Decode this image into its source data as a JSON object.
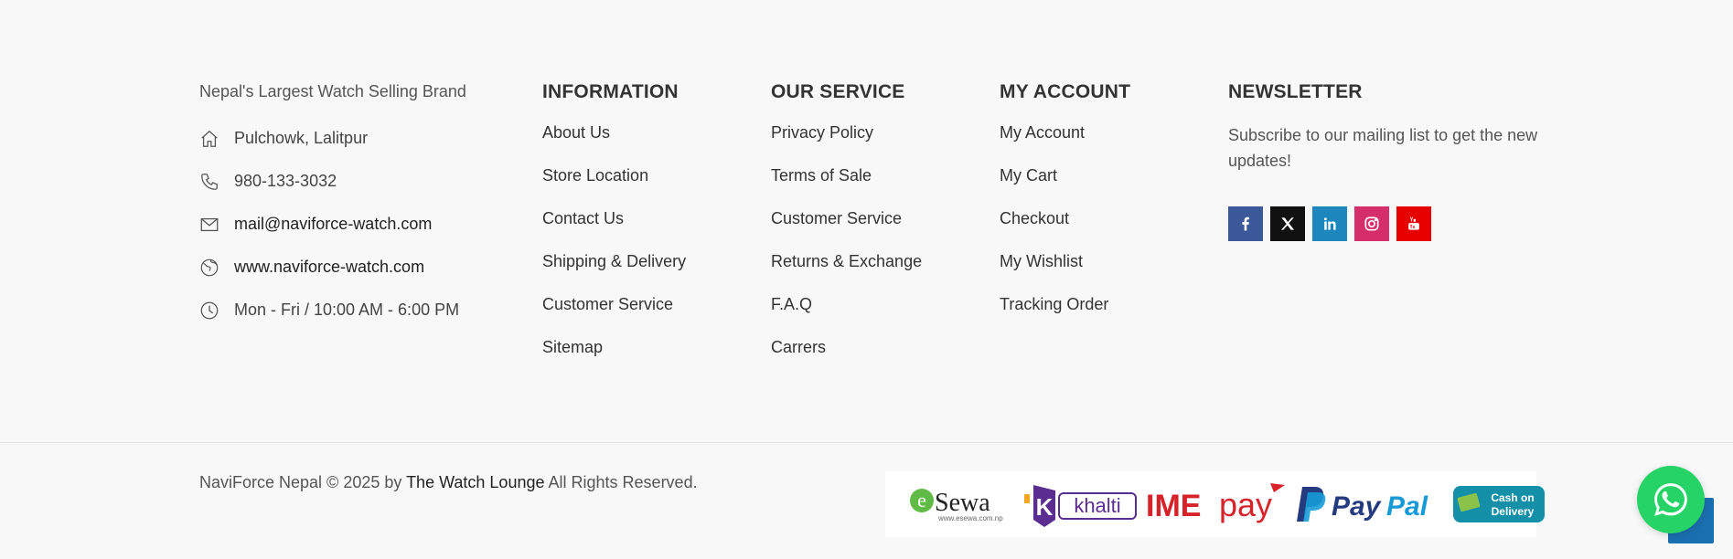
{
  "brand": {
    "tagline": "Nepal's Largest Watch Selling Brand",
    "contacts": [
      {
        "icon": "home-icon",
        "text": "Pulchowk, Lalitpur"
      },
      {
        "icon": "phone-icon",
        "text": "980-133-3032"
      },
      {
        "icon": "mail-icon",
        "text": "mail@naviforce-watch.com"
      },
      {
        "icon": "globe-icon",
        "text": "www.naviforce-watch.com"
      },
      {
        "icon": "clock-icon",
        "text": "Mon - Fri / 10:00 AM - 6:00 PM"
      }
    ]
  },
  "information": {
    "title": "INFORMATION",
    "links": [
      "About Us",
      "Store Location",
      "Contact Us",
      "Shipping & Delivery",
      "Customer Service",
      "Sitemap"
    ]
  },
  "service": {
    "title": "OUR SERVICE",
    "links": [
      "Privacy Policy",
      "Terms of Sale",
      "Customer Service",
      "Returns & Exchange",
      "F.A.Q",
      "Carrers"
    ]
  },
  "account": {
    "title": "MY ACCOUNT",
    "links": [
      "My Account",
      "My Cart",
      "Checkout",
      "My Wishlist",
      "Tracking Order"
    ]
  },
  "newsletter": {
    "title": "NEWSLETTER",
    "text": "Subscribe to our mailing list to get the new updates!",
    "socials": [
      {
        "icon": "facebook-icon",
        "color": "#3b5998"
      },
      {
        "icon": "x-twitter-icon",
        "color": "#111111"
      },
      {
        "icon": "linkedin-icon",
        "color": "#1d87bd"
      },
      {
        "icon": "instagram-icon",
        "color": "#d62e6b"
      },
      {
        "icon": "youtube-icon",
        "color": "#e60000"
      }
    ]
  },
  "bottom": {
    "copyright_prefix": "NaviForce Nepal © 2025 by",
    "copyright_link": "The Watch Lounge",
    "copyright_suffix": "All Rights Reserved.",
    "payments": {
      "esewa": "Sewa",
      "esewa_e": "e",
      "esewa_url": "www.esewa.com.np",
      "khalti": "khalti",
      "khalti_k": "K",
      "imepay_ime": "IME",
      "imepay_pay": "pay",
      "paypal_pay": "Pay",
      "paypal_pal": "Pal",
      "cod_line1": "Cash on",
      "cod_line2": "Delivery"
    }
  }
}
